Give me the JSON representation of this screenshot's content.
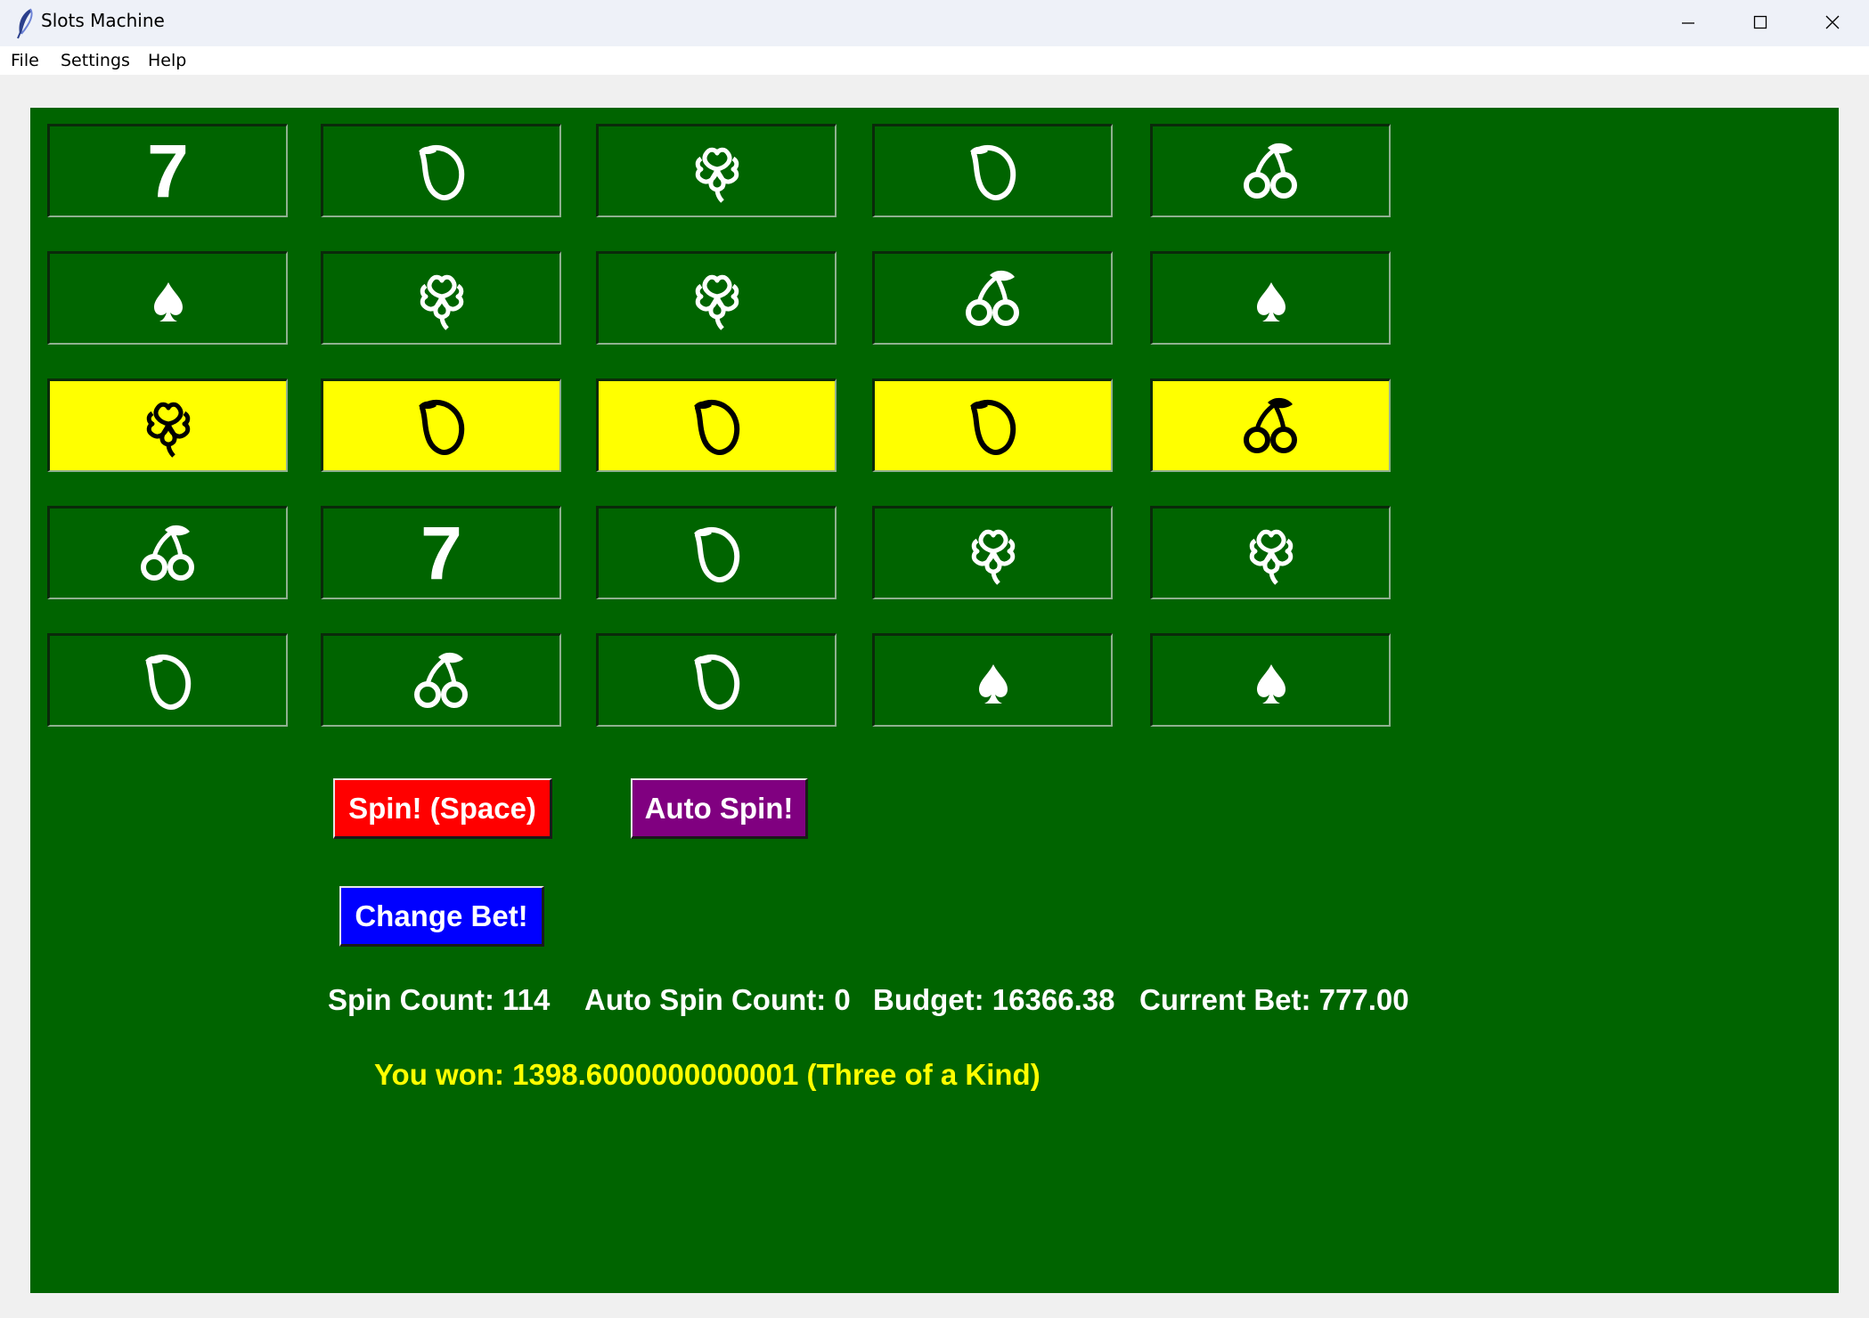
{
  "window": {
    "title": "Slots Machine"
  },
  "menu": {
    "file": "File",
    "settings": "Settings",
    "help": "Help"
  },
  "colors": {
    "table_green": "#006400",
    "win_highlight": "#ffff00",
    "spin_button": "#ff0000",
    "auto_spin_button": "#800080",
    "change_bet_button": "#0000ff",
    "result_text": "#ffff00"
  },
  "reels": {
    "rows": [
      [
        "seven",
        "lemon",
        "clover",
        "lemon",
        "cherry"
      ],
      [
        "spade",
        "clover",
        "clover",
        "cherry",
        "spade"
      ],
      [
        "clover",
        "lemon",
        "lemon",
        "lemon",
        "cherry"
      ],
      [
        "cherry",
        "seven",
        "lemon",
        "clover",
        "clover"
      ],
      [
        "lemon",
        "cherry",
        "lemon",
        "spade",
        "spade"
      ]
    ],
    "winning_row": 3,
    "seven_text": "7"
  },
  "buttons": {
    "spin": "Spin! (Space)",
    "auto_spin": "Auto Spin!",
    "change_bet": "Change Bet!"
  },
  "status": {
    "spin_count": "Spin Count: 114",
    "auto_spin_count": "Auto Spin Count: 0",
    "budget": "Budget: 16366.38",
    "current_bet": "Current Bet: 777.00"
  },
  "result": {
    "text": "You won: 1398.6000000000001 (Three of a Kind)"
  }
}
